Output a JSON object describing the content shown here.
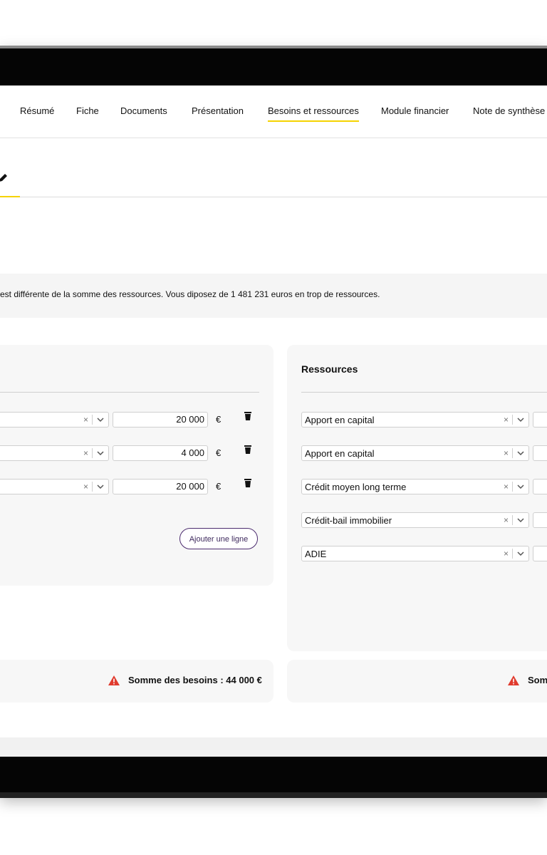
{
  "tabs": [
    {
      "label": "Résumé",
      "active": false
    },
    {
      "label": "Fiche",
      "active": false
    },
    {
      "label": "Documents",
      "active": false
    },
    {
      "label": "Présentation",
      "active": false
    },
    {
      "label": "Besoins et ressources",
      "active": true
    },
    {
      "label": "Module financier",
      "active": false
    },
    {
      "label": "Note de synthèse",
      "active": false
    }
  ],
  "notice": "est différente de la somme des ressources. Vous diposez de 1 481 231 euros en trop de ressources.",
  "needs": {
    "rows": [
      {
        "amount": "20 000",
        "currency": "€"
      },
      {
        "amount": "4 000",
        "currency": "€"
      },
      {
        "amount": "20 000",
        "currency": "€"
      }
    ],
    "add_button": "Ajouter une ligne",
    "sum_label": "Somme des besoins : 44 000 €"
  },
  "resources": {
    "title": "Ressources",
    "rows": [
      {
        "label": "Apport en capital"
      },
      {
        "label": "Apport en capital"
      },
      {
        "label": "Crédit moyen long terme"
      },
      {
        "label": "Crédit-bail immobilier"
      },
      {
        "label": "ADIE"
      }
    ],
    "sum_label": "Som"
  },
  "icons": {
    "clear": "×",
    "clear_icon": "close-icon",
    "chevron_icon": "chevron-down-icon",
    "trash_icon": "trash-icon",
    "warning_icon": "warning-icon",
    "edit_icon": "pencil-icon"
  },
  "colors": {
    "accent": "#f5d300",
    "button_border": "#4b2b6e",
    "warning": "#e03b2e"
  }
}
